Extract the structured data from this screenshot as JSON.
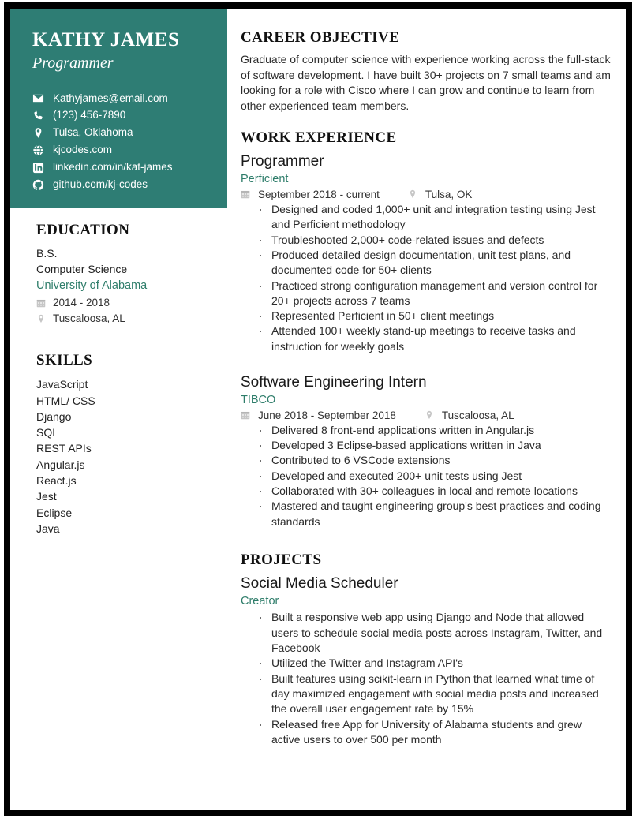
{
  "theme": {
    "sidebar_bg": "#2e7d74",
    "accent_text": "#2e7d6a",
    "body_text": "#2b2b2b",
    "page_border": "#000000"
  },
  "sidebar": {
    "name": "KATHY JAMES",
    "job_title": "Programmer",
    "contacts": [
      {
        "icon": "envelope-icon",
        "text": "Kathyjames@email.com"
      },
      {
        "icon": "phone-icon",
        "text": "(123) 456-7890"
      },
      {
        "icon": "location-pin-icon",
        "text": "Tulsa, Oklahoma"
      },
      {
        "icon": "globe-icon",
        "text": "kjcodes.com"
      },
      {
        "icon": "linkedin-icon",
        "text": "linkedin.com/in/kat-james"
      },
      {
        "icon": "github-icon",
        "text": "github.com/kj-codes"
      }
    ],
    "education": {
      "heading": "EDUCATION",
      "degree": "B.S.",
      "field": "Computer Science",
      "school": "University of Alabama",
      "dates": "2014 - 2018",
      "location": "Tuscaloosa, AL"
    },
    "skills": {
      "heading": "SKILLS",
      "items": [
        "JavaScript",
        "HTML/ CSS",
        "Django",
        "SQL",
        "REST APIs",
        "Angular.js",
        "React.js",
        "Jest",
        "Eclipse",
        "Java"
      ]
    }
  },
  "main": {
    "objective": {
      "heading": "CAREER OBJECTIVE",
      "text": "Graduate of computer science with experience working across the full-stack of software development. I have built 30+ projects on 7 small teams and am looking for a role with Cisco where I can grow and continue to learn from other experienced team members."
    },
    "work": {
      "heading": "WORK EXPERIENCE",
      "entries": [
        {
          "title": "Programmer",
          "org": "Perficient",
          "dates": "September 2018 - current",
          "location": "Tulsa, OK",
          "bullets": [
            "Designed and coded 1,000+ unit and integration testing using Jest and Perficient methodology",
            "Troubleshooted 2,000+ code-related issues and defects",
            "Produced detailed design documentation, unit test plans, and documented code for 50+ clients",
            "Practiced strong configuration management and version control for 20+ projects across 7 teams",
            "Represented Perficient in 50+ client meetings",
            "Attended 100+ weekly stand-up meetings to receive tasks and instruction for weekly goals"
          ]
        },
        {
          "title": "Software Engineering Intern",
          "org": "TIBCO",
          "dates": "June 2018 - September 2018",
          "location": "Tuscaloosa, AL",
          "bullets": [
            "Delivered 8 front-end applications written in Angular.js",
            "Developed 3 Eclipse-based applications written in Java",
            "Contributed to 6 VSCode extensions",
            "Developed and executed 200+ unit tests using Jest",
            "Collaborated with 30+ colleagues in local and remote locations",
            "Mastered and taught engineering group's best practices and coding standards"
          ]
        }
      ]
    },
    "projects": {
      "heading": "PROJECTS",
      "entries": [
        {
          "title": "Social Media Scheduler",
          "role": "Creator",
          "bullets": [
            "Built a responsive web app using Django and Node that allowed users to schedule social media posts across Instagram, Twitter, and Facebook",
            "Utilized the Twitter and Instagram API's",
            "Built features using scikit-learn in Python that learned what time of day maximized engagement with social media posts and increased the overall user engagement rate by 15%",
            "Released free App for University of Alabama students and grew active users to over 500 per month"
          ]
        }
      ]
    }
  }
}
